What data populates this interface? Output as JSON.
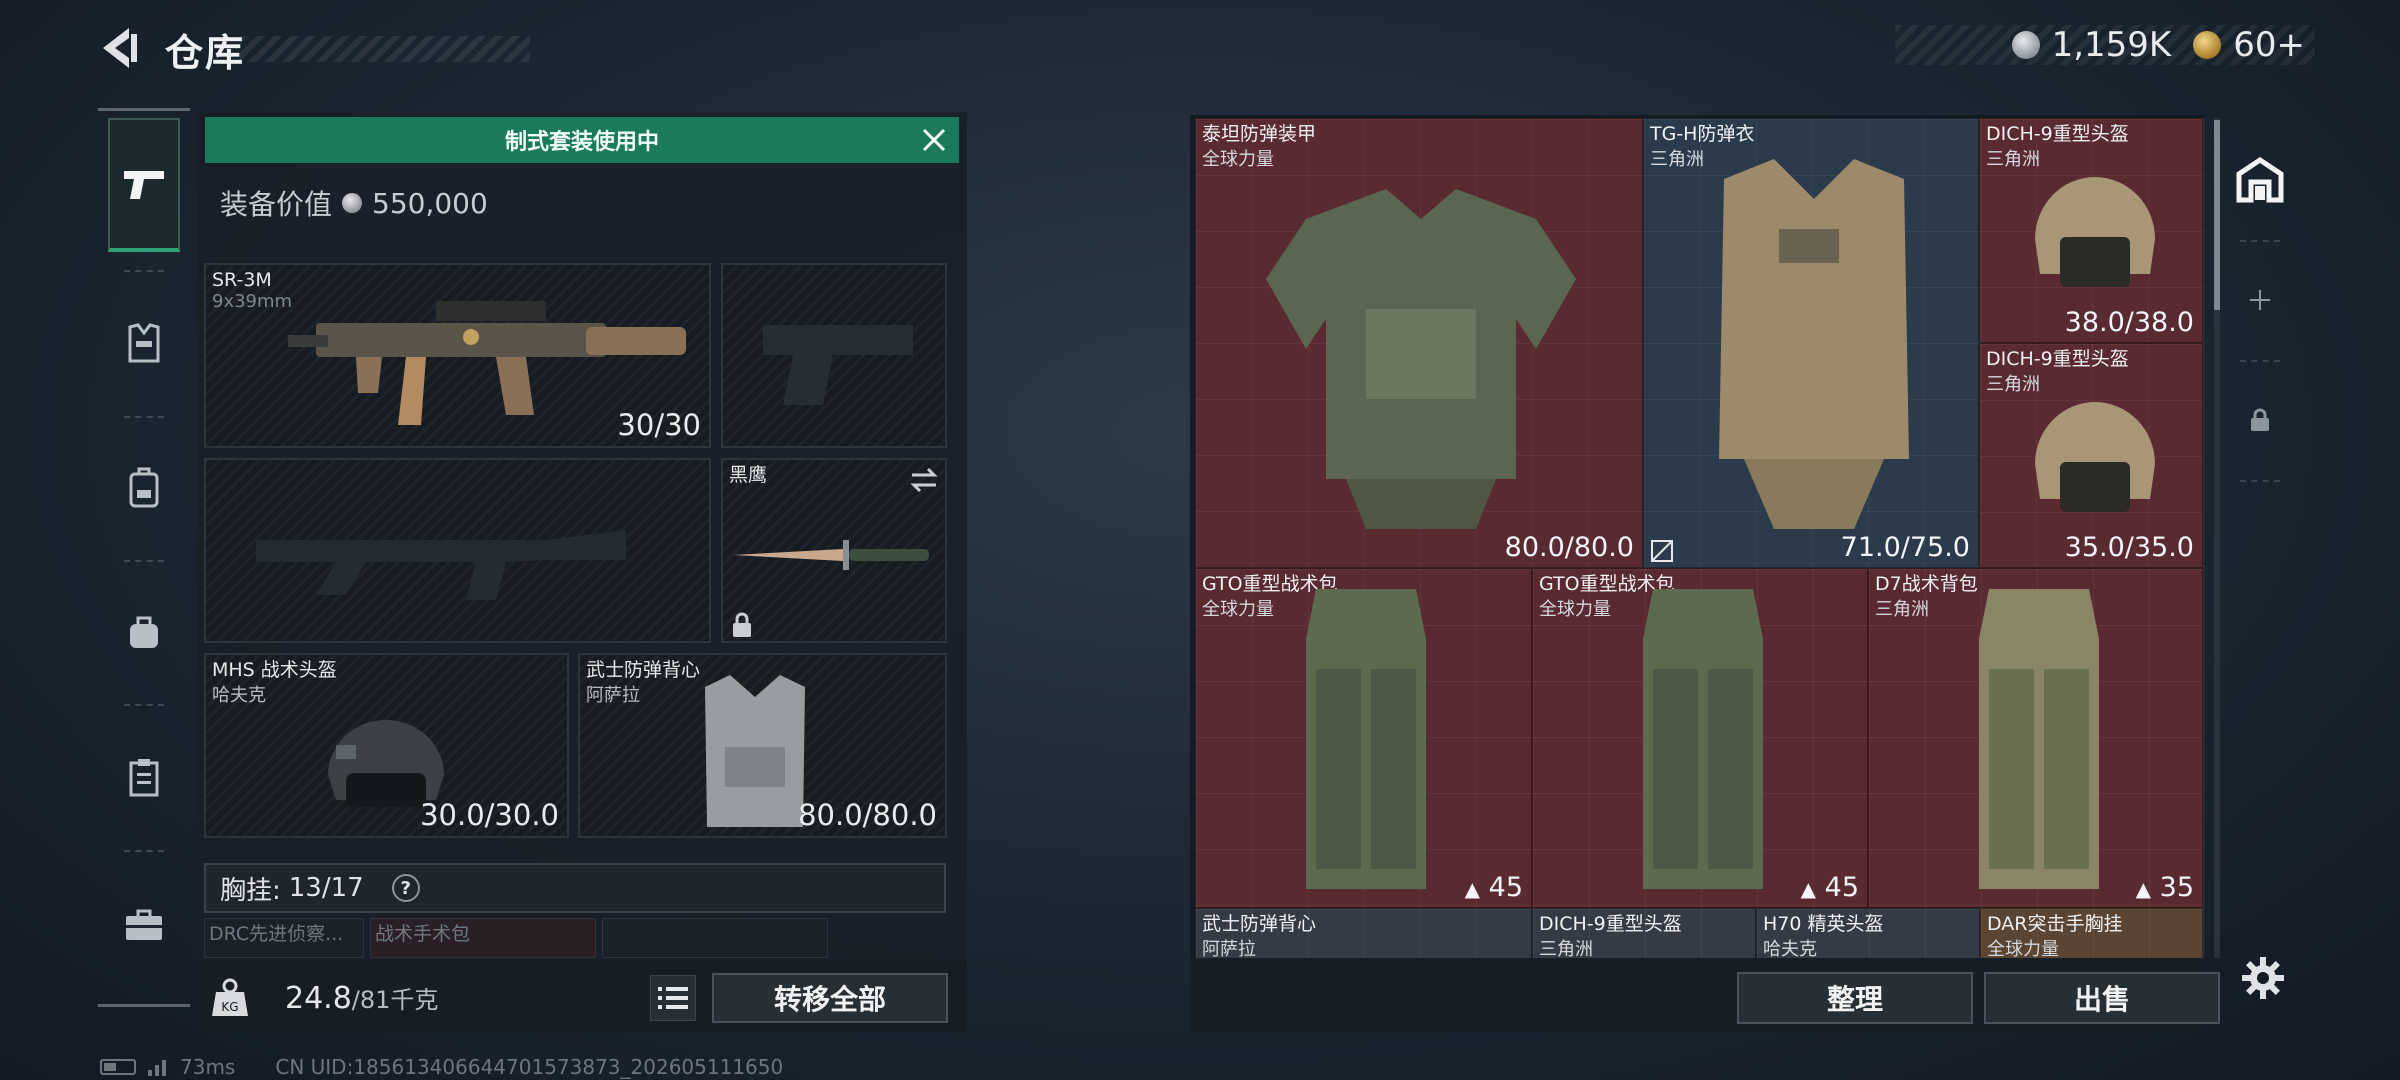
{
  "header": {
    "title": "仓库",
    "currency": [
      {
        "icon": "silver-coin-icon",
        "value": "1,159K"
      },
      {
        "icon": "gold-token-icon",
        "value": "60+"
      }
    ]
  },
  "sidebar": {
    "items": [
      {
        "icon": "pistol-icon",
        "active": true
      },
      {
        "icon": "armor-vest-icon"
      },
      {
        "icon": "backpack-icon"
      },
      {
        "icon": "bag-icon"
      },
      {
        "icon": "clipboard-icon"
      },
      {
        "icon": "toolbox-icon"
      }
    ]
  },
  "loadout": {
    "banner": "制式套装使用中",
    "value_label": "装备价值",
    "value": "550,000",
    "slots": {
      "primary": {
        "name": "SR-3M",
        "sub": "9x39mm",
        "count": "30/30"
      },
      "melee": {
        "name": "黑鹰"
      },
      "helmet": {
        "name": "MHS 战术头盔",
        "sub": "哈夫克",
        "count": "30.0/30.0"
      },
      "armor": {
        "name": "武士防弹背心",
        "sub": "阿萨拉",
        "count": "80.0/80.0"
      }
    },
    "chest": {
      "label": "胸挂:",
      "value": "13/17",
      "help": "?"
    },
    "mini_slots": [
      "DRC先进侦察...",
      "战术手术包",
      ""
    ],
    "weight": {
      "value": "24.8",
      "max": "/81千克",
      "icon_label": "KG"
    },
    "transfer_all": "转移全部"
  },
  "storage": {
    "items": [
      {
        "name": "泰坦防弹装甲",
        "sub": "全球力量",
        "value": "80.0/80.0",
        "tint": "red"
      },
      {
        "name": "TG-H防弹衣",
        "sub": "三角洲",
        "value": "71.0/75.0",
        "tint": "blue"
      },
      {
        "name": "DICH-9重型头盔",
        "sub": "三角洲",
        "value": "38.0/38.0",
        "tint": "red"
      },
      {
        "name": "DICH-9重型头盔",
        "sub": "三角洲",
        "value": "35.0/35.0",
        "tint": "red"
      },
      {
        "name": "GTO重型战术包",
        "sub": "全球力量",
        "value": "45",
        "tint": "red"
      },
      {
        "name": "GTO重型战术包",
        "sub": "全球力量",
        "value": "45",
        "tint": "red"
      },
      {
        "name": "D7战术背包",
        "sub": "三角洲",
        "value": "35",
        "tint": "red"
      },
      {
        "name": "武士防弹背心",
        "sub": "阿萨拉",
        "tint": "dark"
      },
      {
        "name": "DICH-9重型头盔",
        "sub": "三角洲",
        "tint": "dark"
      },
      {
        "name": "H70 精英头盔",
        "sub": "哈夫克",
        "tint": "dark"
      },
      {
        "name": "DAR突击手胸挂",
        "sub": "全球力量",
        "tint": "orange"
      }
    ],
    "sort": "整理",
    "sell": "出售"
  },
  "status": {
    "ping": "73ms",
    "uid": "CN UID:1856134066447015738​73_202605111650"
  }
}
